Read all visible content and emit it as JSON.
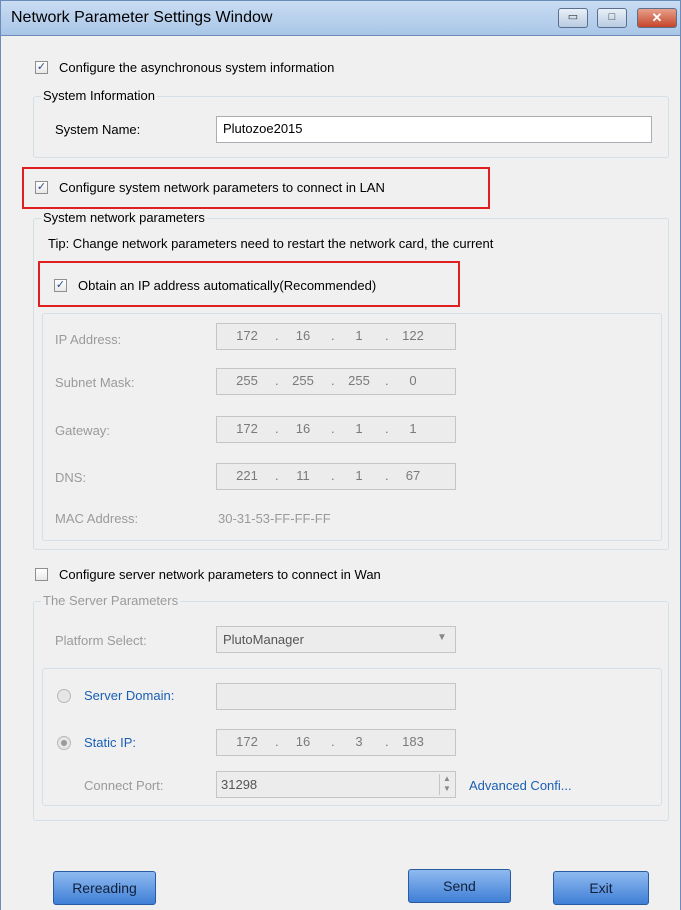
{
  "window": {
    "title": "Network Parameter Settings Window",
    "minimize_glyph": "▭",
    "maximize_glyph": "□",
    "close_glyph": "✕"
  },
  "async_section": {
    "checkbox_label": "Configure the asynchronous system information",
    "checked": true,
    "group_title": "System Information",
    "system_name_label": "System Name:",
    "system_name_value": "Plutozoe2015"
  },
  "lan_section": {
    "checkbox_label": "Configure system network parameters to connect in LAN",
    "checked": true,
    "group_title": "System network parameters",
    "tip": "Tip: Change network parameters need to restart the network card, the current",
    "auto_ip_label": "Obtain an IP address automatically(Recommended)",
    "auto_ip_checked": true,
    "ip_label": "IP Address:",
    "ip": [
      "172",
      "16",
      "1",
      "122"
    ],
    "subnet_label": "Subnet Mask:",
    "subnet": [
      "255",
      "255",
      "255",
      "0"
    ],
    "gateway_label": "Gateway:",
    "gateway": [
      "172",
      "16",
      "1",
      "1"
    ],
    "dns_label": "DNS:",
    "dns": [
      "221",
      "11",
      "1",
      "67"
    ],
    "mac_label": "MAC Address:",
    "mac_value": "30-31-53-FF-FF-FF"
  },
  "wan_section": {
    "checkbox_label": "Configure server network parameters to connect in Wan",
    "checked": false,
    "group_title": "The Server Parameters",
    "platform_label": "Platform Select:",
    "platform_value": "PlutoManager",
    "server_domain_label": "Server Domain:",
    "server_domain_value": "",
    "static_ip_label": "Static IP:",
    "static_ip": [
      "172",
      "16",
      "3",
      "183"
    ],
    "connect_port_label": "Connect Port:",
    "connect_port_value": "31298",
    "advanced_link": "Advanced Confi..."
  },
  "buttons": {
    "rereading": "Rereading",
    "send": "Send",
    "exit": "Exit"
  },
  "colors": {
    "highlight_border": "#e02020",
    "button_blue": "#3f7fd6",
    "link_blue": "#1a5fb4"
  },
  "icons": {
    "checkbox_checked": "check-icon",
    "dropdown": "chevron-down-icon",
    "spin": "spin-arrows-icon"
  }
}
